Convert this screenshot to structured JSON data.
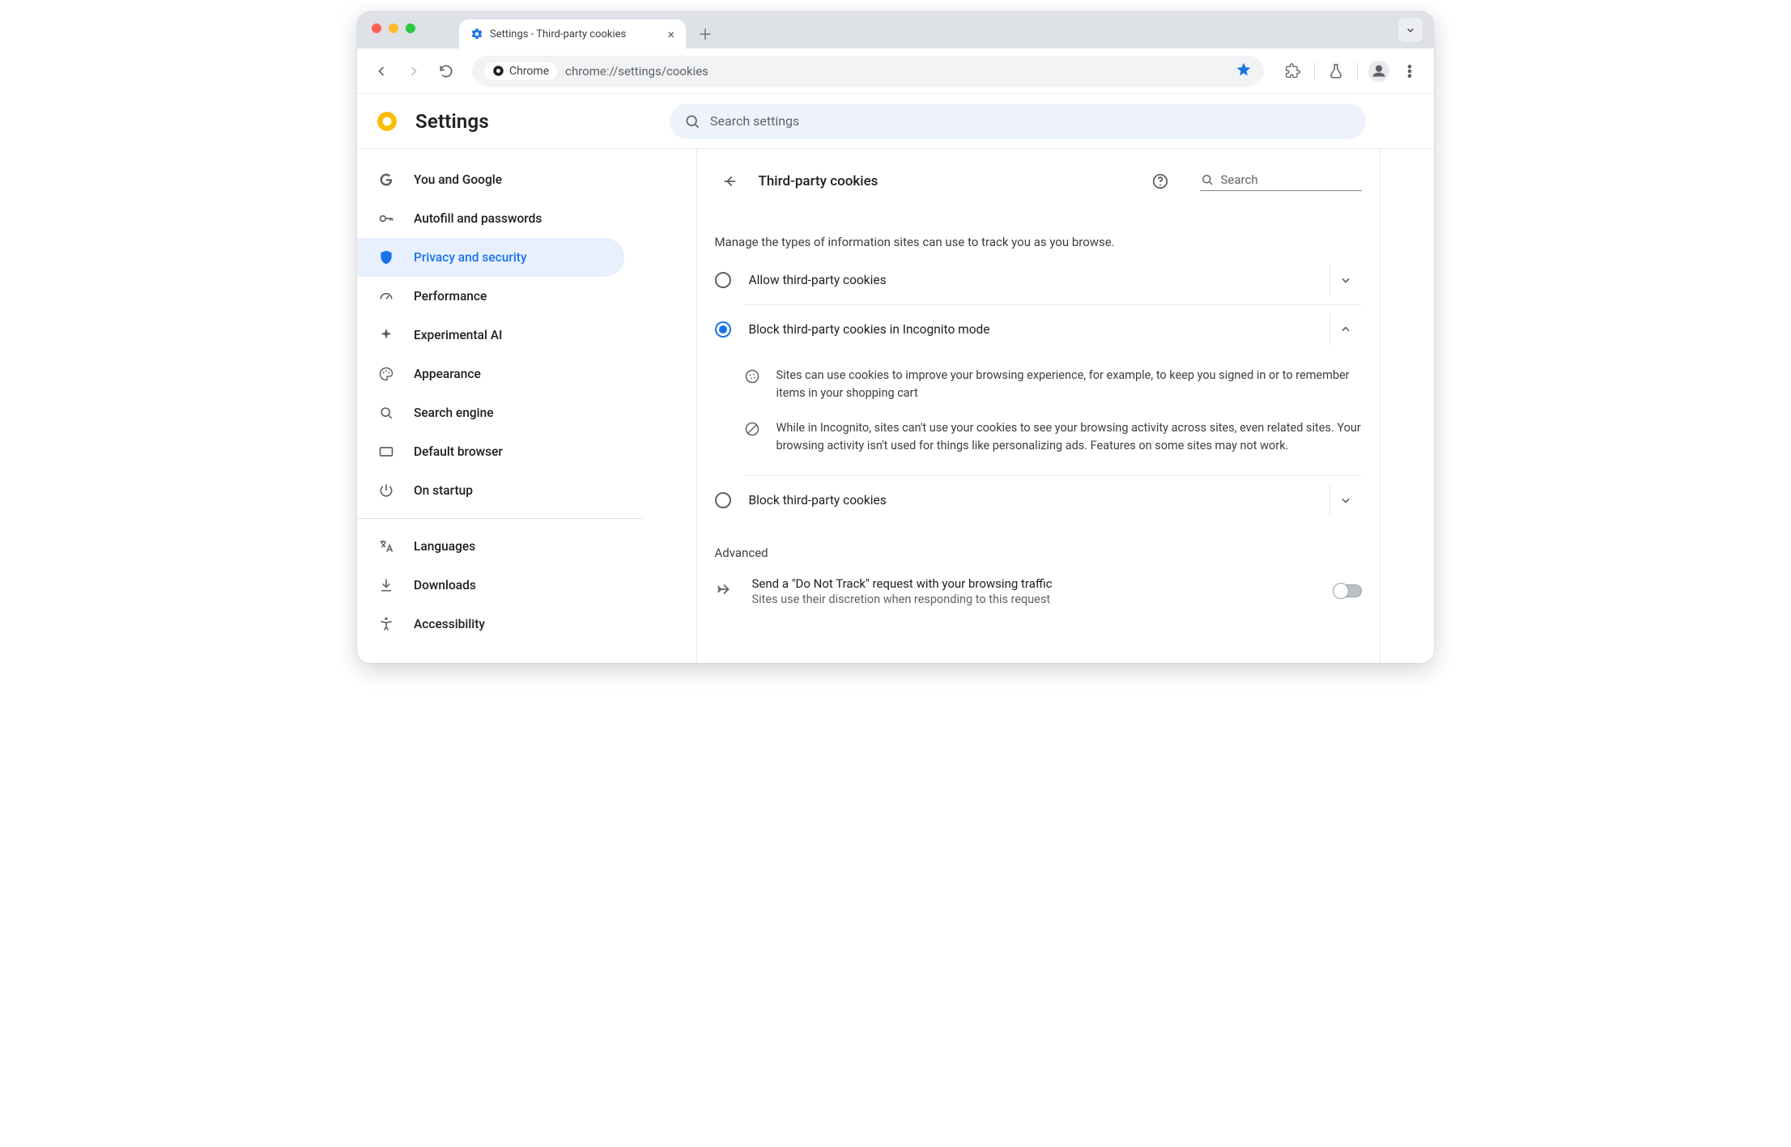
{
  "window": {
    "tab_title": "Settings - Third-party cookies"
  },
  "omnibox": {
    "chip_label": "Chrome",
    "url": "chrome://settings/cookies"
  },
  "header": {
    "title": "Settings",
    "search_placeholder": "Search settings"
  },
  "sidebar": {
    "items": [
      {
        "label": "You and Google"
      },
      {
        "label": "Autofill and passwords"
      },
      {
        "label": "Privacy and security"
      },
      {
        "label": "Performance"
      },
      {
        "label": "Experimental AI"
      },
      {
        "label": "Appearance"
      },
      {
        "label": "Search engine"
      },
      {
        "label": "Default browser"
      },
      {
        "label": "On startup"
      }
    ],
    "items2": [
      {
        "label": "Languages"
      },
      {
        "label": "Downloads"
      },
      {
        "label": "Accessibility"
      }
    ]
  },
  "panel": {
    "title": "Third-party cookies",
    "search_placeholder": "Search",
    "intro": "Manage the types of information sites can use to track you as you browse.",
    "options": [
      {
        "label": "Allow third-party cookies"
      },
      {
        "label": "Block third-party cookies in Incognito mode"
      },
      {
        "label": "Block third-party cookies"
      }
    ],
    "option_details": [
      "Sites can use cookies to improve your browsing experience, for example, to keep you signed in or to remember items in your shopping cart",
      "While in Incognito, sites can't use your cookies to see your browsing activity across sites, even related sites. Your browsing activity isn't used for things like personalizing ads. Features on some sites may not work."
    ],
    "advanced_heading": "Advanced",
    "dnt": {
      "primary": "Send a \"Do Not Track\" request with your browsing traffic",
      "secondary": "Sites use their discretion when responding to this request"
    }
  }
}
